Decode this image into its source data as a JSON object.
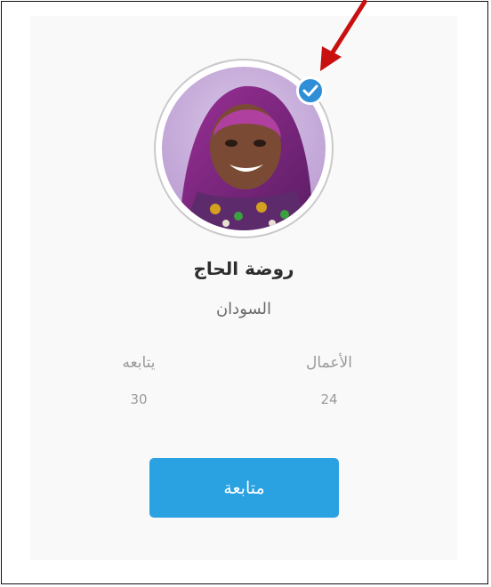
{
  "profile": {
    "name": "روضة الحاج",
    "country": "السودان",
    "verified": true
  },
  "stats": {
    "works_label": "الأعمال",
    "works_value": "24",
    "followers_label": "يتابعه",
    "followers_value": "30"
  },
  "actions": {
    "follow_label": "متابعة"
  },
  "colors": {
    "accent": "#2aa1e1",
    "verified_badge": "#2e8fd6",
    "annotation_arrow": "#c81010"
  },
  "icons": {
    "verified": "checkmark-badge-icon",
    "annotation": "arrow-icon"
  }
}
